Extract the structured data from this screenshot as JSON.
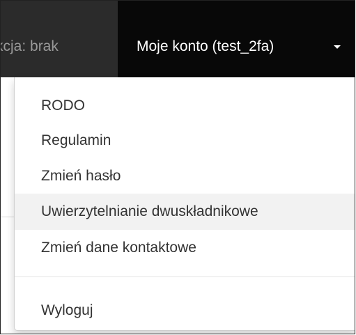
{
  "navbar": {
    "context_text": "kcja: brak",
    "account_label": "Moje konto (test_2fa)",
    "caret_icon": "caret-down-icon"
  },
  "dropdown": {
    "items": [
      {
        "label": "RODO"
      },
      {
        "label": "Regulamin"
      },
      {
        "label": "Zmień hasło"
      },
      {
        "label": "Uwierzytelnianie dwuskładnikowe"
      },
      {
        "label": "Zmień dane kontaktowe"
      }
    ],
    "logout_label": "Wyloguj",
    "highlighted_item": "Uwierzytelnianie dwuskładnikowe"
  },
  "colors": {
    "navbar_bg": "#080808",
    "context_bg": "#2b2b2b",
    "highlight_bg": "#f2f2f2",
    "text": "#333333"
  }
}
